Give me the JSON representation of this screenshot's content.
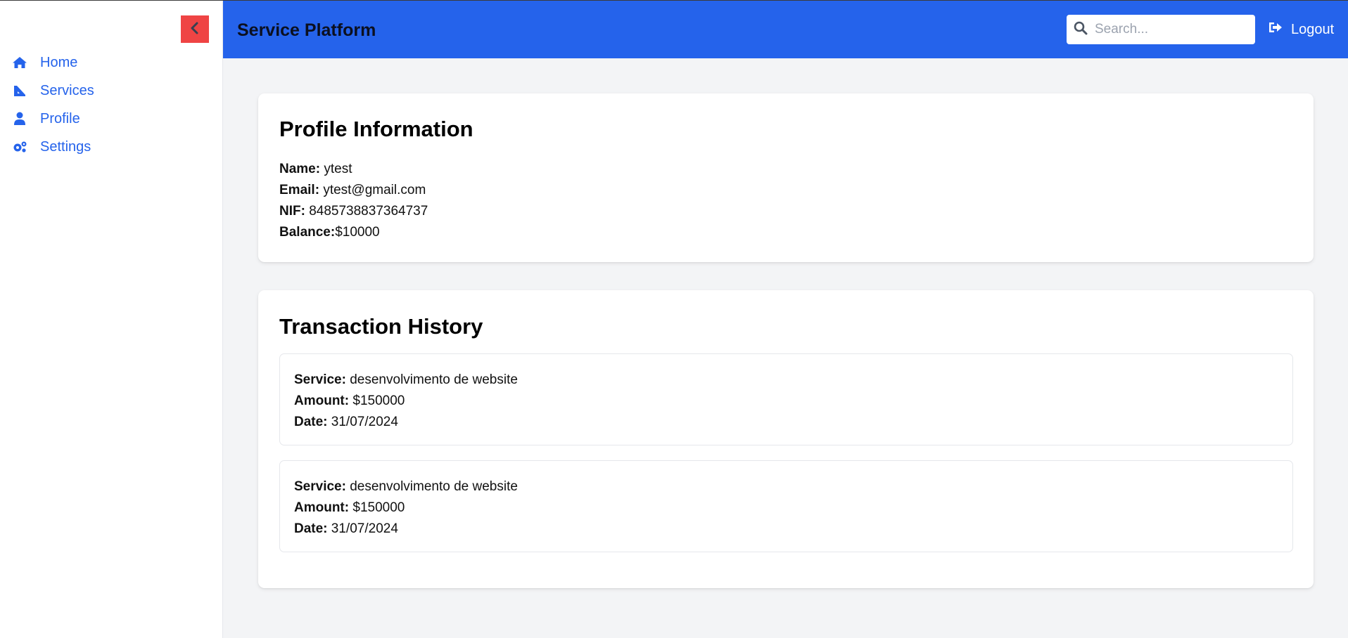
{
  "header": {
    "title": "Service Platform",
    "search_placeholder": "Search...",
    "logout_label": "Logout"
  },
  "sidebar": {
    "collapse_icon": "chevron-left-icon",
    "items": [
      {
        "label": "Home",
        "icon": "home-icon"
      },
      {
        "label": "Services",
        "icon": "services-icon"
      },
      {
        "label": "Profile",
        "icon": "user-icon"
      },
      {
        "label": "Settings",
        "icon": "gears-icon"
      }
    ]
  },
  "profile": {
    "title": "Profile Information",
    "name_label": "Name:",
    "name": "ytest",
    "email_label": "Email:",
    "email": "ytest@gmail.com",
    "nif_label": "NIF:",
    "nif": "8485738837364737",
    "balance_label": "Balance:",
    "balance": "$10000"
  },
  "history": {
    "title": "Transaction History",
    "service_label": "Service:",
    "amount_label": "Amount:",
    "date_label": "Date:",
    "transactions": [
      {
        "service": "desenvolvimento de website",
        "amount": "$150000",
        "date": "31/07/2024"
      },
      {
        "service": "desenvolvimento de website",
        "amount": "$150000",
        "date": "31/07/2024"
      }
    ]
  },
  "colors": {
    "accent": "#2563eb",
    "collapse_button": "#ef4444",
    "background": "#f3f4f6"
  }
}
